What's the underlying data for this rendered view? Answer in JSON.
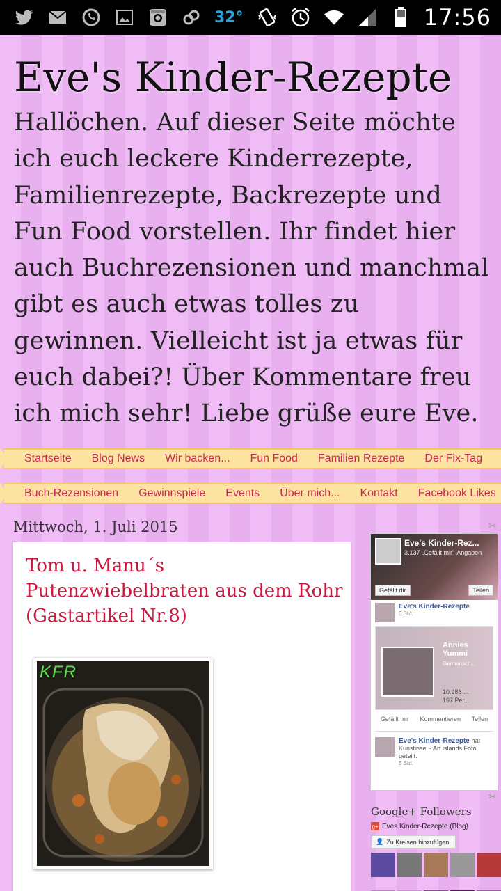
{
  "status_bar": {
    "temperature": "32°",
    "time": "17:56",
    "left_icons": [
      "twitter-icon",
      "gmail-icon",
      "whatsapp-icon",
      "gallery-icon",
      "instagram-icon",
      "link-icon"
    ],
    "right_icons": [
      "vibrate-icon",
      "alarm-icon",
      "wifi-icon",
      "signal-icon",
      "battery-icon"
    ]
  },
  "header": {
    "title": "Eve's Kinder-Rezepte",
    "description": "Hallöchen. Auf dieser Seite möchte ich euch leckere Kinderrezepte, Familienrezepte, Backrezepte und Fun Food vorstellen. Ihr findet hier auch Buchrezensionen und manchmal gibt es auch etwas tolles zu gewinnen. Vielleicht ist ja etwas für euch dabei?! Über Kommentare freu ich mich sehr! Liebe grüße eure Eve."
  },
  "nav1": [
    "Startseite",
    "Blog News",
    "Wir backen...",
    "Fun Food",
    "Familien Rezepte",
    "Der Fix-Tag"
  ],
  "nav2": [
    "Buch-Rezensionen",
    "Gewinnspiele",
    "Events",
    "Über mich...",
    "Kontakt",
    "Facebook Likes"
  ],
  "post": {
    "date": "Mittwoch, 1. Juli 2015",
    "title": "Tom u. Manu´s Putenzwiebelbraten aus dem Rohr (Gastartikel Nr.8)",
    "image_watermark": "KFR"
  },
  "facebook_widget": {
    "page_name": "Eve's Kinder-Rez...",
    "likes": "3.137 „Gefällt mir\"-Angaben",
    "like_button": "Gefällt dir",
    "share_button": "Teilen",
    "post_author": "Eve's Kinder-Rezepte",
    "post_time": "5 Std.",
    "shared_title": "Annies Yummi",
    "shared_sub": "Gemeinsch...",
    "shared_count": "10.988 ...",
    "shared_count2": "197 Per...",
    "action_like": "Gefällt mir",
    "action_comment": "Kommentieren",
    "action_share": "Teilen",
    "post2_author": "Eve's Kinder-Rezepte",
    "post2_text": "hat Kunstinsel - Art islands Foto geteilt.",
    "post2_time": "5 Std."
  },
  "gplus": {
    "title": "Google+ Followers",
    "page": "Eves Kinder-Rezepte (Blog)",
    "button": "Zu Kreisen hinzufügen"
  },
  "colors": {
    "background": "#efbcf5",
    "title_accent": "#c8183f",
    "nav_text": "#c8285a",
    "ribbon": "#fde3a0"
  }
}
